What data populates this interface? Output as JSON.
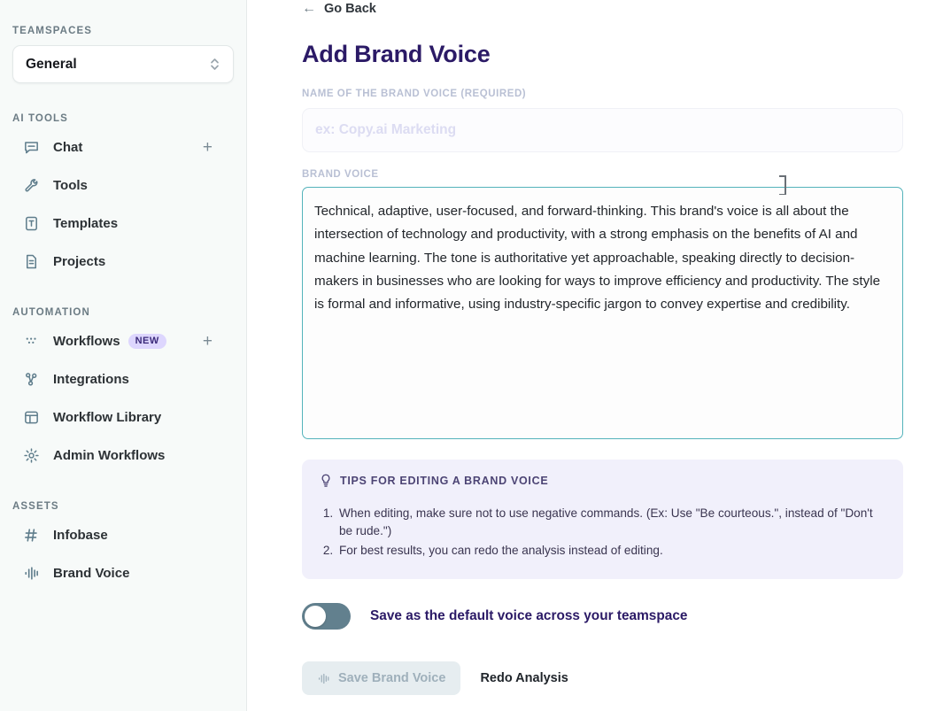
{
  "sidebar": {
    "teamspaces_label": "TEAMSPACES",
    "teamspace_selected": "General",
    "groups": [
      {
        "label": "AI TOOLS",
        "items": [
          {
            "label": "Chat",
            "icon": "chat-bubble-icon",
            "plus": true
          },
          {
            "label": "Tools",
            "icon": "wrench-icon",
            "plus": false
          },
          {
            "label": "Templates",
            "icon": "template-icon",
            "plus": false
          },
          {
            "label": "Projects",
            "icon": "document-icon",
            "plus": false
          }
        ]
      },
      {
        "label": "AUTOMATION",
        "items": [
          {
            "label": "Workflows",
            "icon": "dots-grid-icon",
            "badge": "NEW",
            "plus": true
          },
          {
            "label": "Integrations",
            "icon": "nodes-icon",
            "plus": false
          },
          {
            "label": "Workflow Library",
            "icon": "layout-icon",
            "plus": false
          },
          {
            "label": "Admin Workflows",
            "icon": "gear-icon",
            "plus": false
          }
        ]
      },
      {
        "label": "ASSETS",
        "items": [
          {
            "label": "Infobase",
            "icon": "hash-icon",
            "plus": false
          },
          {
            "label": "Brand Voice",
            "icon": "waveform-icon",
            "plus": false
          }
        ]
      }
    ]
  },
  "main": {
    "go_back": "Go Back",
    "title": "Add Brand Voice",
    "name_field": {
      "label": "NAME OF THE BRAND VOICE (REQUIRED)",
      "value": "",
      "placeholder": "ex: Copy.ai Marketing"
    },
    "brand_voice_field": {
      "label": "BRAND VOICE",
      "value": "Technical, adaptive, user-focused, and forward-thinking. This brand's voice is all about the intersection of technology and productivity, with a strong emphasis on the benefits of AI and machine learning. The tone is authoritative yet approachable, speaking directly to decision-makers in businesses who are looking for ways to improve efficiency and productivity. The style is formal and informative, using industry-specific jargon to convey expertise and credibility."
    },
    "tips": {
      "heading": "TIPS FOR EDITING A BRAND VOICE",
      "icon": "lightbulb-icon",
      "items": [
        "When editing, make sure not to use negative commands. (Ex: Use \"Be courteous.\", instead of \"Don't be rude.\")",
        "For best results, you can redo the analysis instead of editing."
      ]
    },
    "default_toggle": {
      "label": "Save as the default voice across your teamspace",
      "state": "off"
    },
    "buttons": {
      "save": "Save Brand Voice",
      "save_disabled": true,
      "redo": "Redo Analysis"
    }
  },
  "colors": {
    "title": "#2b1a66",
    "textarea_border": "#54b3bb",
    "tips_bg": "#f1f0fb",
    "badge_bg": "#ddd6fe",
    "badge_text": "#3b2a7a",
    "sidebar_bg": "#f7faf9",
    "toggle_track": "#62808e",
    "save_btn_bg": "#e6edf0"
  }
}
